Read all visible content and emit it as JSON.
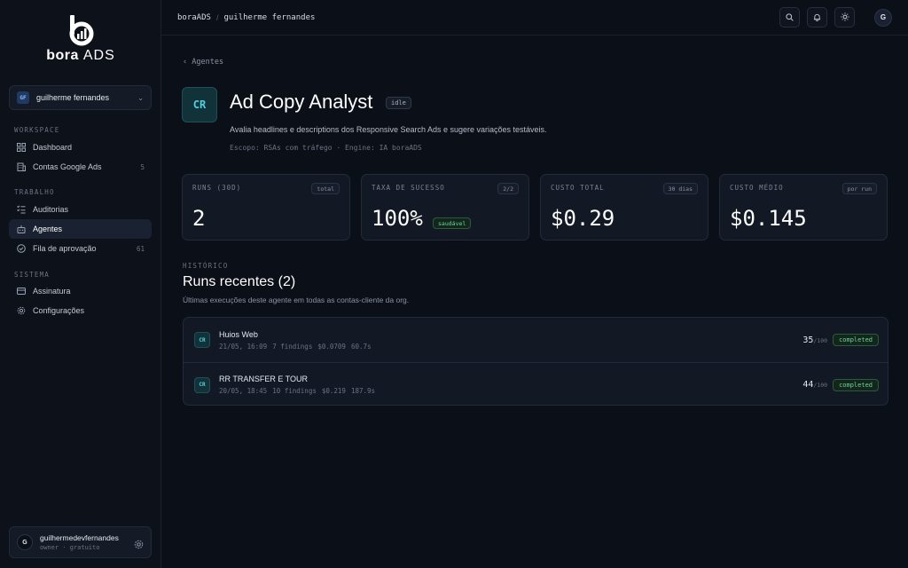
{
  "brand": {
    "logo_mark": "b",
    "logo_text_bold": "bora",
    "logo_text_light": "ADS"
  },
  "org_switcher": {
    "avatar": "GF",
    "name": "guilherme fernandes"
  },
  "sidebar": {
    "sections": [
      {
        "title": "WORKSPACE",
        "items": [
          {
            "label": "Dashboard",
            "icon": "grid-icon",
            "count": ""
          },
          {
            "label": "Contas Google Ads",
            "icon": "building-icon",
            "count": "5"
          }
        ]
      },
      {
        "title": "TRABALHO",
        "items": [
          {
            "label": "Auditorias",
            "icon": "list-check-icon",
            "count": ""
          },
          {
            "label": "Agentes",
            "icon": "bot-icon",
            "count": "",
            "active": true
          },
          {
            "label": "Fila de aprovação",
            "icon": "check-circle-icon",
            "count": "61"
          }
        ]
      },
      {
        "title": "SISTEMA",
        "items": [
          {
            "label": "Assinatura",
            "icon": "card-icon",
            "count": ""
          },
          {
            "label": "Configurações",
            "icon": "gear-icon",
            "count": ""
          }
        ]
      }
    ]
  },
  "user": {
    "avatar": "G",
    "name": "guilhermedevfernandes",
    "role": "owner · gratuito"
  },
  "topbar": {
    "breadcrumb": [
      "boraADS",
      "guilherme fernandes"
    ],
    "separator": "/",
    "avatar": "G"
  },
  "agent": {
    "back_label": "‹ Agentes",
    "badge": "CR",
    "title": "Ad Copy Analyst",
    "status": "idle",
    "description": "Avalia headlines e descriptions dos Responsive Search Ads e sugere variações testáveis.",
    "meta": "Escopo: RSAs com tráfego · Engine: IA boraADS"
  },
  "stats": [
    {
      "label": "RUNS (30D)",
      "tag": "total",
      "value": "2"
    },
    {
      "label": "TAXA DE SUCESSO",
      "tag": "2/2",
      "value": "100%",
      "health": "saudável"
    },
    {
      "label": "CUSTO TOTAL",
      "tag": "30 dias",
      "value": "$0.29"
    },
    {
      "label": "CUSTO MÉDIO",
      "tag": "por run",
      "value": "$0.145"
    }
  ],
  "history": {
    "eyebrow": "HISTÓRICO",
    "title": "Runs recentes (2)",
    "subtitle": "Últimas execuções deste agente em todas as contas-cliente da org.",
    "runs": [
      {
        "badge": "CR",
        "name": "Huios Web",
        "date": "21/05, 16:09",
        "findings": "7 findings",
        "cost": "$0.0709",
        "duration": "60.7s",
        "score": "35",
        "max": "/100",
        "status": "completed"
      },
      {
        "badge": "CR",
        "name": "RR TRANSFER E TOUR",
        "date": "20/05, 18:45",
        "findings": "10 findings",
        "cost": "$0.219",
        "duration": "187.9s",
        "score": "44",
        "max": "/100",
        "status": "completed"
      }
    ]
  }
}
